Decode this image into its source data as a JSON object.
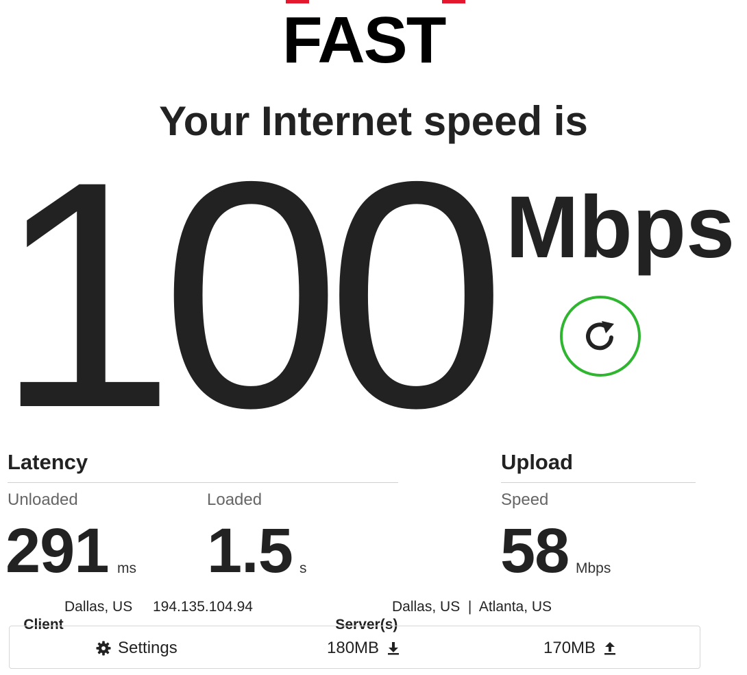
{
  "logo": {
    "text": "FAST",
    "accent_color": "#e3172d"
  },
  "headline": "Your Internet speed is",
  "download": {
    "value": "100",
    "unit": "Mbps"
  },
  "refresh": {
    "icon": "refresh-icon",
    "color": "#2fb52f"
  },
  "latency": {
    "title": "Latency",
    "unloaded": {
      "label": "Unloaded",
      "value": "291",
      "unit": "ms"
    },
    "loaded": {
      "label": "Loaded",
      "value": "1.5",
      "unit": "s"
    }
  },
  "upload": {
    "title": "Upload",
    "speed": {
      "label": "Speed",
      "value": "58",
      "unit": "Mbps"
    }
  },
  "client": {
    "label": "Client",
    "location": "Dallas, US",
    "ip": "194.135.104.94"
  },
  "servers": {
    "label": "Server(s)",
    "value": "Dallas, US  |  Atlanta, US"
  },
  "footer": {
    "settings_label": "Settings",
    "settings_icon": "gear-icon",
    "download_data": "180MB",
    "download_icon": "download-icon",
    "upload_data": "170MB",
    "upload_icon": "upload-icon"
  }
}
